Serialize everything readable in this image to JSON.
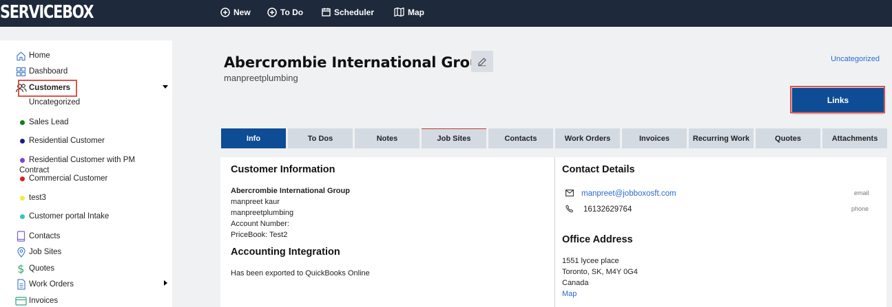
{
  "app": {
    "logo": "SERVICEBOX"
  },
  "topnav": [
    {
      "label": "New",
      "icon": "plus-circle-icon"
    },
    {
      "label": "To Do",
      "icon": "plus-circle-icon"
    },
    {
      "label": "Scheduler",
      "icon": "calendar-icon"
    },
    {
      "label": "Map",
      "icon": "map-icon"
    }
  ],
  "sidebar": {
    "items": [
      {
        "label": "Home",
        "icon": "home-icon"
      },
      {
        "label": "Dashboard",
        "icon": "dashboard-icon"
      },
      {
        "label": "Customers",
        "icon": "users-icon"
      },
      {
        "label": "Contacts",
        "icon": "contacts-icon"
      },
      {
        "label": "Job Sites",
        "icon": "location-pin-icon"
      },
      {
        "label": "Quotes",
        "icon": "dollar-icon"
      },
      {
        "label": "Work Orders",
        "icon": "document-icon"
      },
      {
        "label": "Invoices",
        "icon": "invoice-icon"
      }
    ],
    "customer_types": [
      {
        "label": "Uncategorized",
        "color": ""
      },
      {
        "label": "Sales Lead",
        "color": "#1a7a1a"
      },
      {
        "label": "Residential Customer",
        "color": "#1a1a8c"
      },
      {
        "label": "Residential Customer with PM",
        "label2": "Contract",
        "color": "#7b3fe4"
      },
      {
        "label": "Commercial Customer",
        "color": "#e01b1b"
      },
      {
        "label": "test3",
        "color": "#f2ee3c"
      },
      {
        "label": "Customer portal Intake",
        "color": "#2fc7b6"
      }
    ]
  },
  "header": {
    "title": "Abercrombie International Group",
    "subtitle": "manpreetplumbing",
    "category_link": "Uncategorized",
    "links_button": "Links"
  },
  "tabs": [
    "Info",
    "To Dos",
    "Notes",
    "Job Sites",
    "Contacts",
    "Work Orders",
    "Invoices",
    "Recurring Work",
    "Quotes",
    "Attachments"
  ],
  "info": {
    "customer_info_heading": "Customer Information",
    "company": "Abercrombie International Group",
    "contact_name": "manpreet kaur",
    "account_name": "manpreetplumbing",
    "account_number": "Account Number:",
    "pricebook": "PriceBook: Test2",
    "accounting_heading": "Accounting Integration",
    "accounting_status": "Has been exported to QuickBooks Online"
  },
  "contact_details": {
    "heading": "Contact Details",
    "email": "manpreet@jobboxosft.com",
    "email_label": "email",
    "phone": "16132629764",
    "phone_label": "phone"
  },
  "office_address": {
    "heading": "Office Address",
    "line1": "1551 lycee place",
    "line2": "Toronto, SK, M4Y 0G4",
    "line3": "Canada",
    "map_link": "Map"
  },
  "colors": {
    "topbar": "#1e2a3b",
    "accent": "#0f4c96",
    "link": "#2a6ccf",
    "highlight": "#d9534f"
  }
}
